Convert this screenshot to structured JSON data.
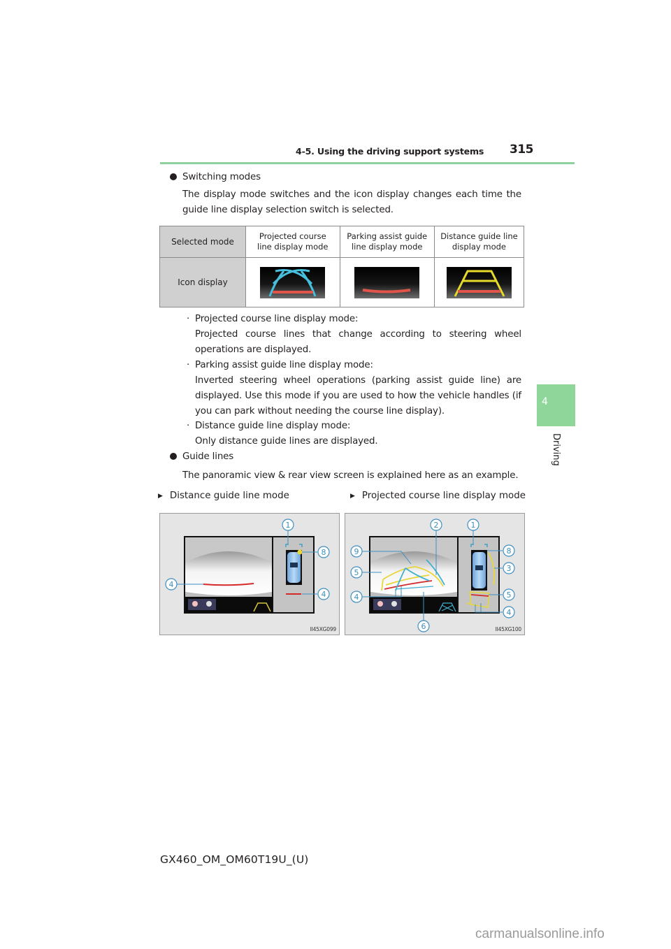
{
  "header": {
    "section_title": "4-5. Using the driving support systems",
    "page_number": "315"
  },
  "side_tab": {
    "chapter_number": "4",
    "chapter_label": "Driving"
  },
  "switching_modes": {
    "heading": "Switching modes",
    "paragraph": "The display mode switches and the icon display changes each time the guide line display selection switch is selected."
  },
  "mode_table": {
    "row_header_1": "Selected mode",
    "row_header_2": "Icon display",
    "columns": [
      {
        "mode": "Projected course line display mode",
        "icon": "projected-course-lines-icon"
      },
      {
        "mode": "Parking assist guide line display mode",
        "icon": "parking-assist-guide-line-icon"
      },
      {
        "mode": "Distance guide line display mode",
        "icon": "distance-guide-lines-icon"
      }
    ]
  },
  "mode_descriptions": [
    {
      "title": "Projected course line display mode:",
      "text": "Projected course lines that change according to steering wheel operations are displayed."
    },
    {
      "title": "Parking assist guide line display mode:",
      "text": "Inverted steering wheel operations (parking assist guide line) are displayed. Use this mode if you are used to how the vehicle handles (if you can park without needing the course line display)."
    },
    {
      "title": "Distance guide line display mode:",
      "text": "Only distance guide lines are displayed."
    }
  ],
  "guide_lines": {
    "heading": "Guide lines",
    "paragraph": "The panoramic view & rear view screen is explained here as an example."
  },
  "figures": [
    {
      "caption": "Distance guide line mode",
      "code": "II45XG099",
      "callouts": [
        "1",
        "8",
        "4",
        "4"
      ]
    },
    {
      "caption": "Projected course line display mode",
      "code": "II45XG100",
      "callouts": [
        "2",
        "1",
        "8",
        "9",
        "3",
        "5",
        "5",
        "4",
        "4",
        "6"
      ]
    }
  ],
  "colors": {
    "accent_green": "#8fd19e",
    "guide_red": "#d62a2a",
    "guide_yellow": "#e8d63a",
    "guide_cyan": "#3fb0d0",
    "callout_blue": "#3f8fc0"
  },
  "footer": {
    "doc_code": "GX460_OM_OM60T19U_(U)"
  },
  "watermark": "carmanualsonline.info"
}
